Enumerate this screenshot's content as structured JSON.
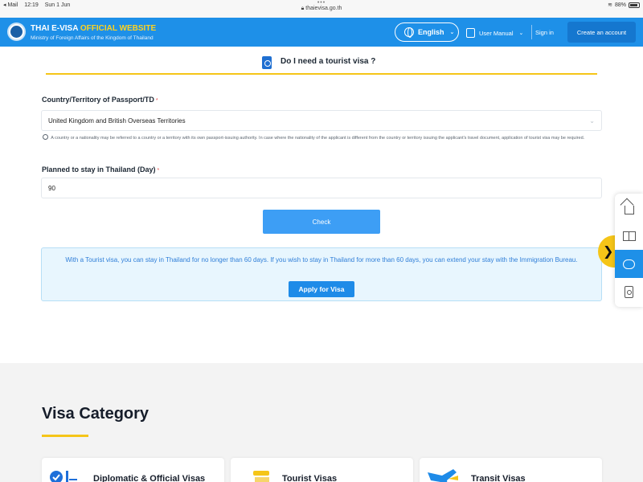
{
  "statusbar": {
    "app": "◂ Mail",
    "time": "12:19",
    "date": "Sun 1 Jun",
    "url": "thaievisa.go.th",
    "battery": "88%"
  },
  "header": {
    "brand_prefix": "THAI E-VISA",
    "brand_highlight": "OFFICIAL WEBSITE",
    "subtitle": "Ministry of Foreign Affairs of the Kingdom of Thailand",
    "language": "English",
    "user_manual": "User Manual",
    "sign_in": "Sign in",
    "create_account": "Create an account"
  },
  "form": {
    "heading": "Do I need a tourist visa ?",
    "country_label": "Country/Territory of Passport/TD",
    "country_value": "United Kingdom and British Overseas Territories",
    "country_hint": "A country or a nationality may be referred to a country or a territory with its own passport-issuing authority. In case where the nationality of the applicant is different from the country or territory issuing the applicant's travel document, application of tourist visa may be required.",
    "stay_label": "Planned to stay in Thailand (Day)",
    "stay_value": "90",
    "required_mark": "*",
    "check_button": "Check"
  },
  "result": {
    "message": "With a Tourist visa, you can stay in Thailand for no longer than 60 days. If you wish to stay in Thailand for more than 60 days, you can extend your stay with the Immigration Bureau.",
    "apply_button": "Apply for Visa"
  },
  "side_panel": {
    "items": [
      "home-icon",
      "manual-book-icon",
      "chat-help-icon",
      "passport-icon"
    ],
    "active_index": 2,
    "toggle_glyph": "❯"
  },
  "category": {
    "title": "Visa Category",
    "cards": [
      {
        "label": "Diplomatic & Official Visas"
      },
      {
        "label": "Tourist Visas"
      },
      {
        "label": "Transit Visas"
      }
    ]
  },
  "colors": {
    "primary": "#1e90e8",
    "accent": "#f5c518",
    "info_bg": "#e8f6fe"
  }
}
